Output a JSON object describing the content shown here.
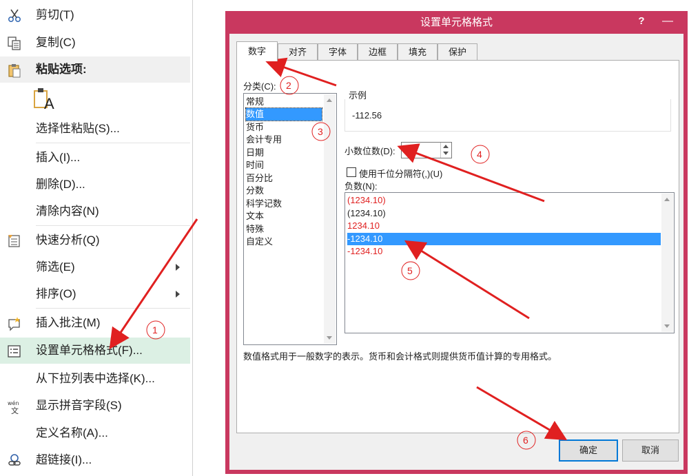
{
  "context_menu": {
    "items": [
      {
        "label": "剪切(T)",
        "icon": "scissors-icon"
      },
      {
        "label": "复制(C)",
        "icon": "copy-icon"
      },
      {
        "label": "粘贴选项:",
        "icon": "clipboard-icon"
      },
      {
        "label": "选择性粘贴(S)...",
        "icon": ""
      },
      {
        "label": "插入(I)...",
        "icon": ""
      },
      {
        "label": "删除(D)...",
        "icon": ""
      },
      {
        "label": "清除内容(N)",
        "icon": ""
      },
      {
        "label": "快速分析(Q)",
        "icon": "quick-analysis-icon"
      },
      {
        "label": "筛选(E)",
        "icon": ""
      },
      {
        "label": "排序(O)",
        "icon": ""
      },
      {
        "label": "插入批注(M)",
        "icon": "comment-icon"
      },
      {
        "label": "设置单元格格式(F)...",
        "icon": "format-cells-icon"
      },
      {
        "label": "从下拉列表中选择(K)...",
        "icon": ""
      },
      {
        "label": "显示拼音字段(S)",
        "icon": "phonetic-icon"
      },
      {
        "label": "定义名称(A)...",
        "icon": ""
      },
      {
        "label": "超链接(I)...",
        "icon": "link-icon"
      }
    ],
    "paste_option_glyph": "A"
  },
  "dialog": {
    "title": "设置单元格格式",
    "help_glyph": "?",
    "minimize_glyph": "—",
    "tabs": [
      "数字",
      "对齐",
      "字体",
      "边框",
      "填充",
      "保护"
    ],
    "category_label": "分类(C):",
    "categories": [
      "常规",
      "数值",
      "货币",
      "会计专用",
      "日期",
      "时间",
      "百分比",
      "分数",
      "科学记数",
      "文本",
      "特殊",
      "自定义"
    ],
    "sample_label": "示例",
    "sample_value": "-112.56",
    "decimal_label": "小数位数(D):",
    "decimal_value": "2",
    "thousands_label": "使用千位分隔符(,)(U)",
    "negative_label": "负数(N):",
    "negatives": [
      {
        "text": "(1234.10)",
        "color": "#e02020"
      },
      {
        "text": "(1234.10)",
        "color": "#222222"
      },
      {
        "text": "1234.10",
        "color": "#e02020"
      },
      {
        "text": "-1234.10",
        "color": "#222222"
      },
      {
        "text": "-1234.10",
        "color": "#e02020"
      }
    ],
    "description": "数值格式用于一般数字的表示。货币和会计格式则提供货币值计算的专用格式。",
    "ok_label": "确定",
    "cancel_label": "取消"
  },
  "annotations": {
    "steps": [
      "1",
      "2",
      "3",
      "4",
      "5",
      "6"
    ],
    "color": "#e02020"
  }
}
